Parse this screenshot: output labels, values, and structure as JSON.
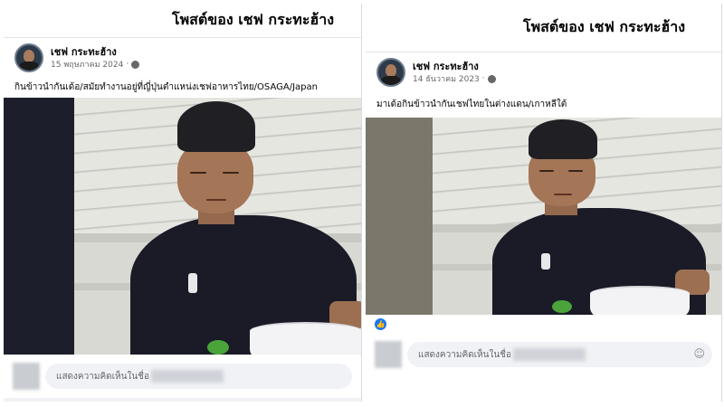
{
  "left_post": {
    "header_title": "โพสต์ของ เชฟ กระทะฮ้าง",
    "author": "เชฟ กระทะฮ้าง",
    "date": "15 พฤษภาคม 2024",
    "caption": "กินข้าวนำกันเด้อ/สมัยทำงานอยู่ที่ญี่ปุ่นตำแหน่งเชฟอาหารไทย/OSAGA/Japan",
    "comment_placeholder": "แสดงความคิดเห็นในชื่อ"
  },
  "right_post": {
    "header_title": "โพสต์ของ เชฟ กระทะฮ้าง",
    "author": "เชฟ กระทะฮ้าง",
    "date": "14 ธันวาคม 2023",
    "caption": "มาเด้อกินข้าวนำกันเชฟไทยในต่างแดน/เกาหลีใต้",
    "comment_placeholder": "แสดงความคิดเห็นในชื่อ"
  },
  "icons": {
    "privacy": "globe-icon",
    "like": "like-icon",
    "sticker": "sticker-icon"
  },
  "colors": {
    "like_blue": "#1877f2",
    "page_bg": "#f0f2f5"
  }
}
